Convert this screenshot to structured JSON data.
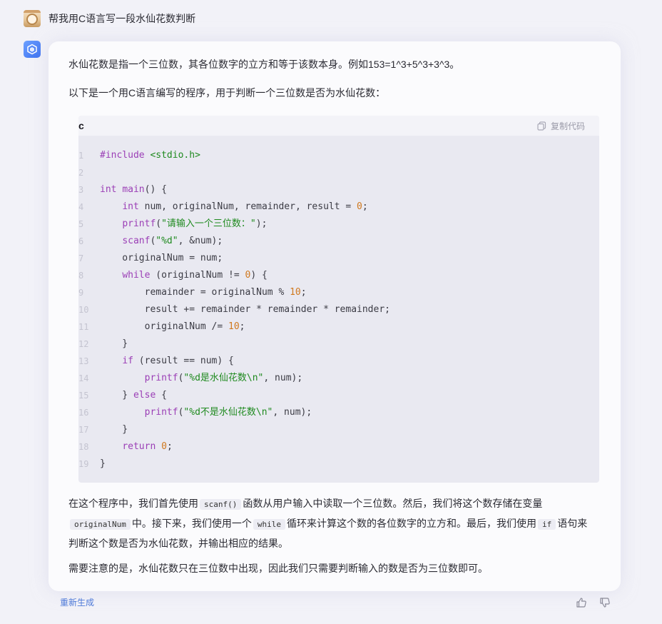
{
  "user_message": "帮我用C语言写一段水仙花数判断",
  "answer": {
    "intro": "水仙花数是指一个三位数，其各位数字的立方和等于该数本身。例如153=1^3+5^3+3^3。",
    "lead": "以下是一个用C语言编写的程序，用于判断一个三位数是否为水仙花数：",
    "code_lang": "c",
    "copy_label": "复制代码",
    "code_lines": [
      {
        "n": "1",
        "html": "<span class=\"fn\">#include</span> <span class=\"inc\">&lt;stdio.h&gt;</span>"
      },
      {
        "n": "2",
        "html": ""
      },
      {
        "n": "3",
        "html": "<span class=\"kw\">int</span> <span class=\"fn\">main</span>() {"
      },
      {
        "n": "4",
        "html": "    <span class=\"kw\">int</span> num, originalNum, remainder, result = <span class=\"num\">0</span>;"
      },
      {
        "n": "5",
        "html": "    <span class=\"fn\">printf</span>(<span class=\"str\">\"请输入一个三位数：\"</span>);"
      },
      {
        "n": "6",
        "html": "    <span class=\"fn\">scanf</span>(<span class=\"str\">\"%d\"</span>, &amp;num);"
      },
      {
        "n": "7",
        "html": "    originalNum = num;"
      },
      {
        "n": "8",
        "html": "    <span class=\"kw\">while</span> (originalNum != <span class=\"num\">0</span>) {"
      },
      {
        "n": "9",
        "html": "        remainder = originalNum % <span class=\"num\">10</span>;"
      },
      {
        "n": "10",
        "html": "        result += remainder * remainder * remainder;"
      },
      {
        "n": "11",
        "html": "        originalNum /= <span class=\"num\">10</span>;"
      },
      {
        "n": "12",
        "html": "    }"
      },
      {
        "n": "13",
        "html": "    <span class=\"kw\">if</span> (result == num) {"
      },
      {
        "n": "14",
        "html": "        <span class=\"fn\">printf</span>(<span class=\"str\">\"%d是水仙花数\\n\"</span>, num);"
      },
      {
        "n": "15",
        "html": "    } <span class=\"kw\">else</span> {"
      },
      {
        "n": "16",
        "html": "        <span class=\"fn\">printf</span>(<span class=\"str\">\"%d不是水仙花数\\n\"</span>, num);"
      },
      {
        "n": "17",
        "html": "    }"
      },
      {
        "n": "18",
        "html": "    <span class=\"kw\">return</span> <span class=\"num\">0</span>;"
      },
      {
        "n": "19",
        "html": "}"
      }
    ],
    "explain_parts": [
      "在这个程序中，我们首先使用",
      "scanf()",
      "函数从用户输入中读取一个三位数。然后，我们将这个数存储在变量",
      "originalNum",
      "中。接下来，我们使用一个",
      "while",
      "循环来计算这个数的各位数字的立方和。最后，我们使用",
      "if",
      "语句来判断这个数是否为水仙花数，并输出相应的结果。"
    ],
    "note": "需要注意的是，水仙花数只在三位数中出现，因此我们只需要判断输入的数是否为三位数即可。"
  },
  "footer": {
    "regenerate_label": "重新生成"
  },
  "colors": {
    "accent": "#4d79d8",
    "bot_avatar": "#3a6ff0",
    "code_bg": "#e9e9f1"
  },
  "icons": {
    "copy": "copy-icon",
    "thumb_up": "thumb-up-icon",
    "thumb_down": "thumb-down-icon",
    "bot": "bot-cube-icon"
  }
}
